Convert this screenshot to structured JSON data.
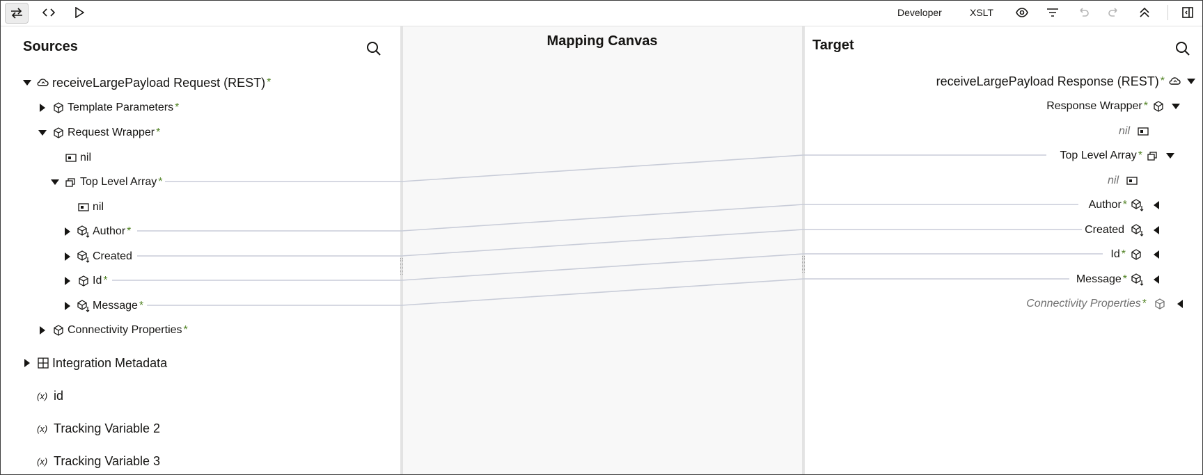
{
  "toolbar": {
    "mode_label": "Developer",
    "xslt_label": "XSLT"
  },
  "sources": {
    "title": "Sources",
    "root": "receiveLargePayload Request (REST)",
    "template_parameters": "Template Parameters",
    "request_wrapper": "Request Wrapper",
    "nil1": "nil",
    "top_level_array": "Top Level Array",
    "nil2": "nil",
    "author": "Author",
    "created": "Created",
    "id": "Id",
    "message": "Message",
    "connectivity_properties": "Connectivity Properties",
    "integration_metadata": "Integration Metadata",
    "var_id": "id",
    "tracking_variable_2": "Tracking Variable 2",
    "tracking_variable_3": "Tracking Variable 3",
    "var_symbol": "(x)",
    "required_mark": "*"
  },
  "canvas": {
    "title": "Mapping Canvas"
  },
  "target": {
    "title": "Target",
    "root": "receiveLargePayload Response (REST)",
    "response_wrapper": "Response Wrapper",
    "nil1": "nil",
    "top_level_array": "Top Level Array",
    "nil2": "nil",
    "author": "Author",
    "created": "Created",
    "id": "Id",
    "message": "Message",
    "connectivity_properties": "Connectivity Properties",
    "required_mark": "*"
  },
  "colors": {
    "required": "#508223",
    "mapping_line": "#c8ccd8",
    "divider": "#e3e3e3"
  }
}
